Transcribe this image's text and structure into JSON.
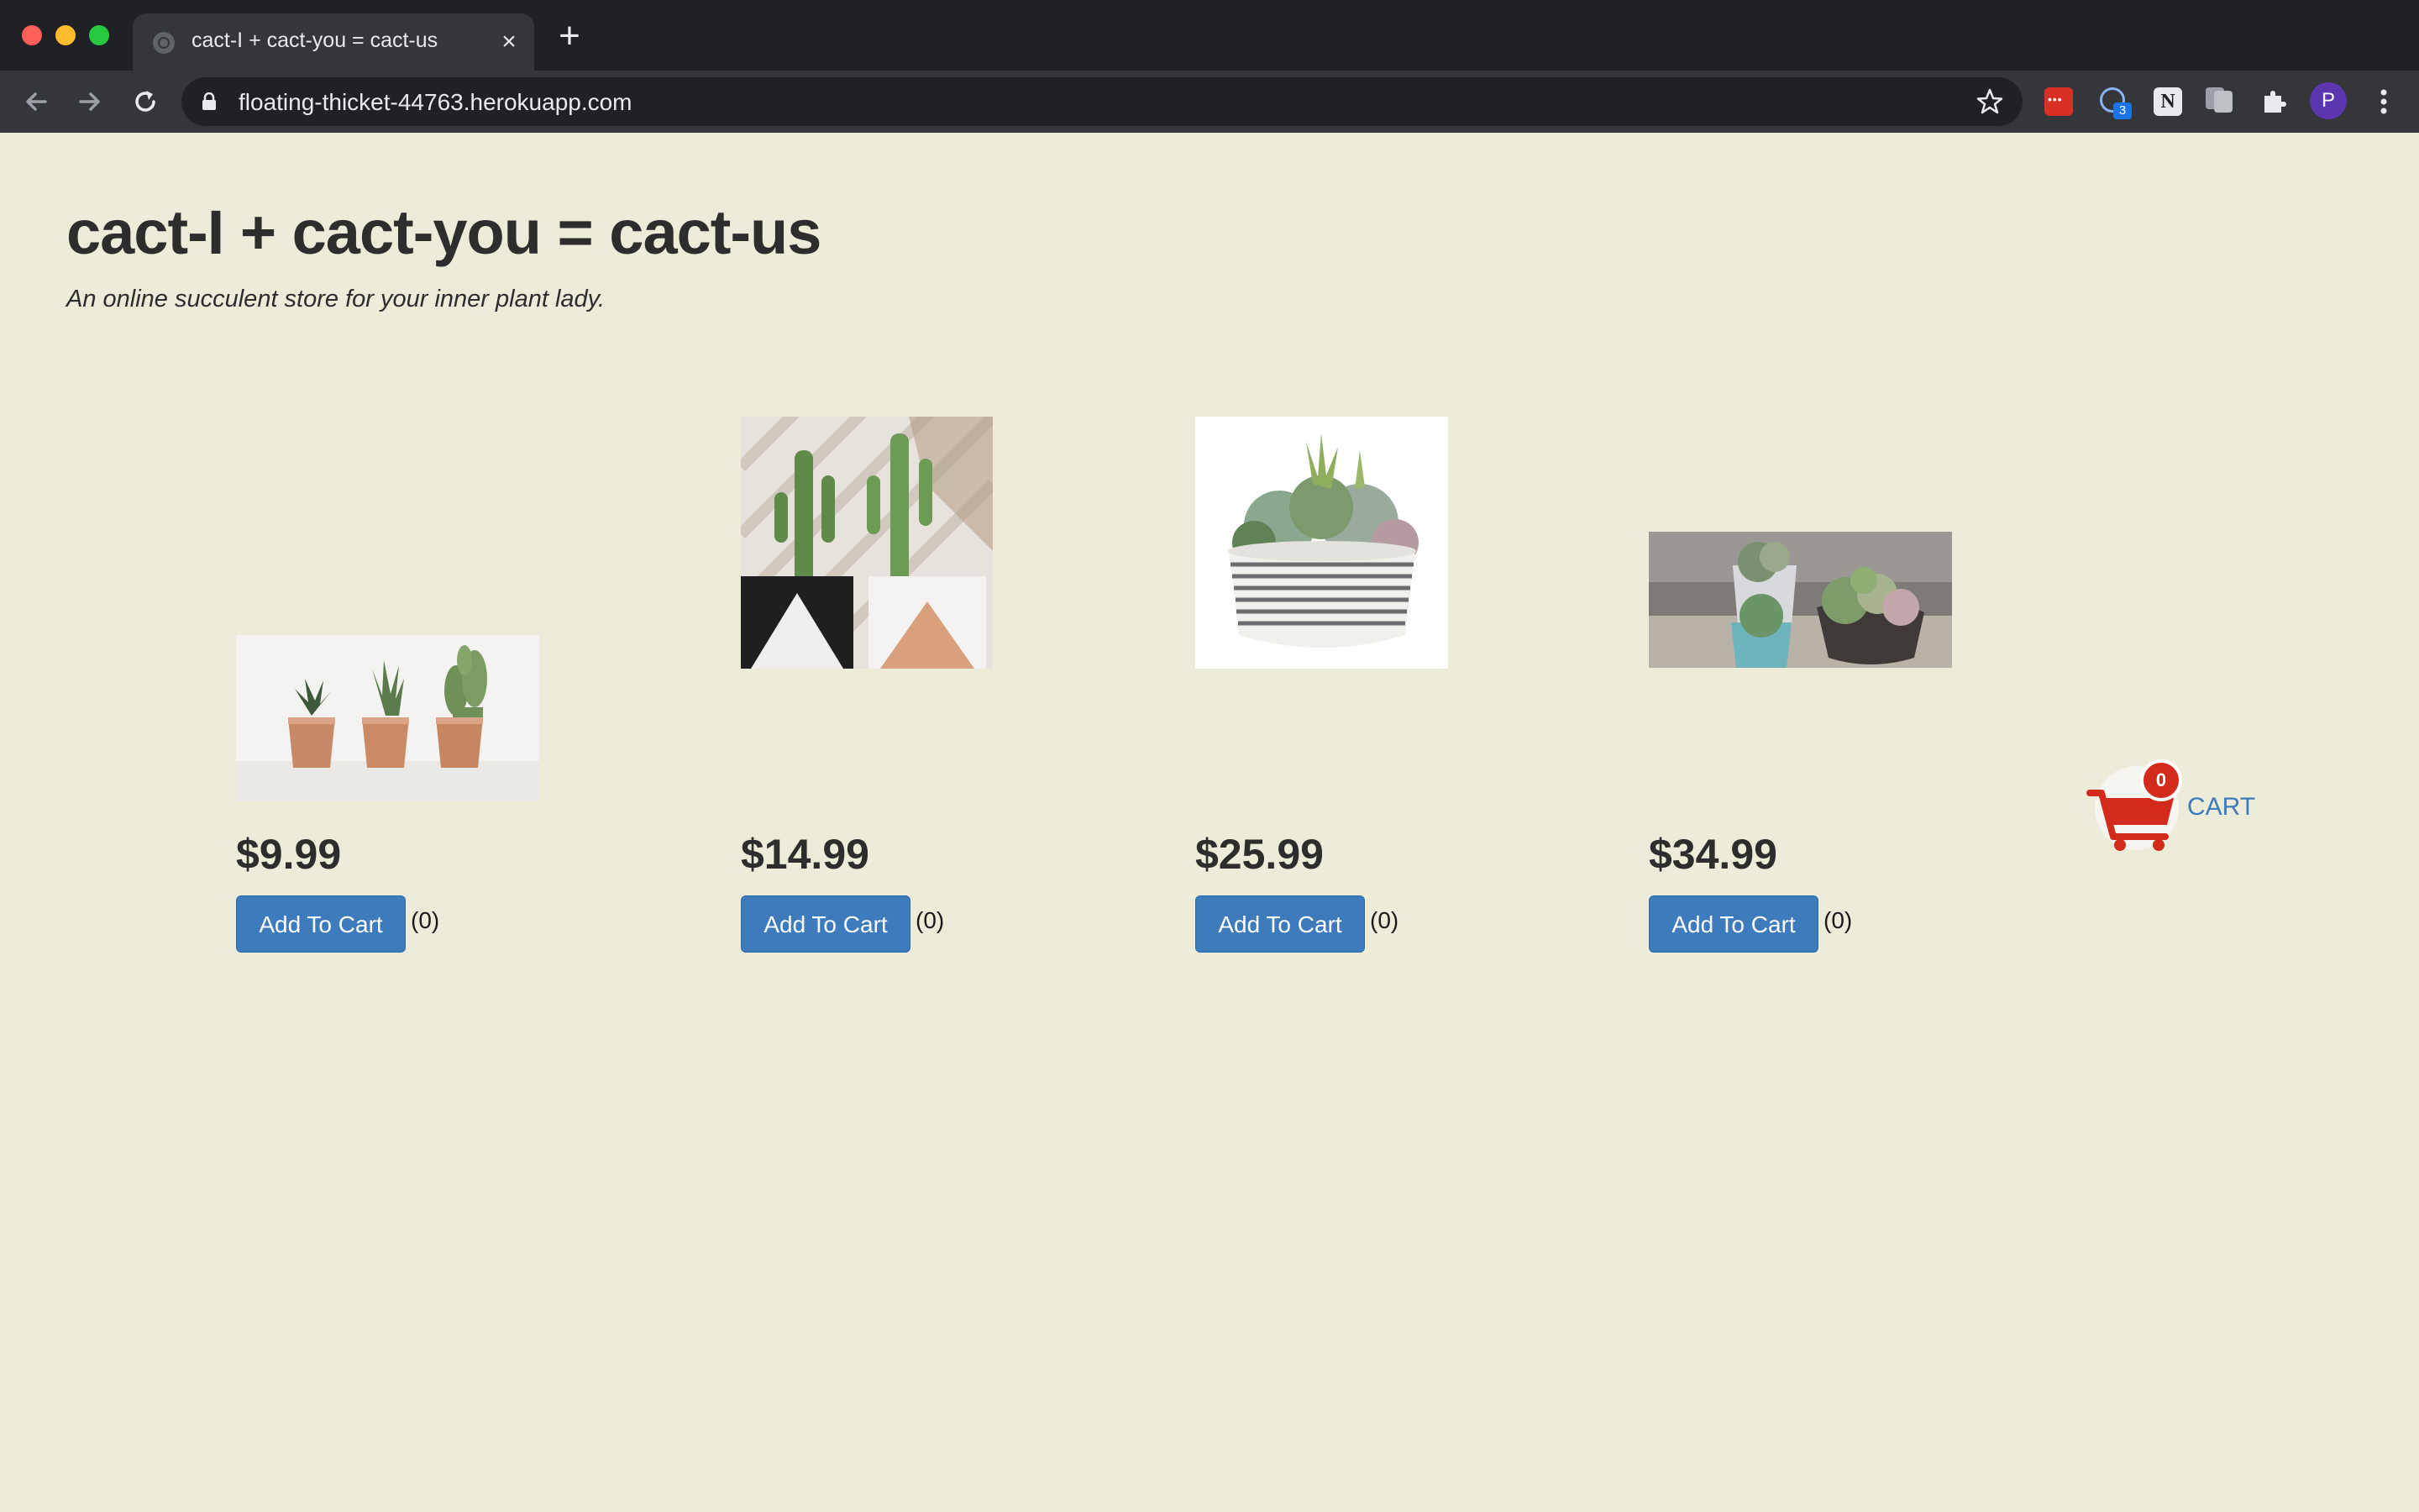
{
  "browser": {
    "tab_title": "cact-I + cact-you = cact-us",
    "close_glyph": "×",
    "new_tab_glyph": "+",
    "url": "floating-thicket-44763.herokuapp.com",
    "extension_badge": "3",
    "extension_notion": "N",
    "profile_initial": "P",
    "icons": [
      "back-arrow-icon",
      "forward-arrow-icon",
      "reload-icon",
      "lock-icon",
      "bookmark-star-icon",
      "extensions-puzzle-icon",
      "kebab-menu-icon"
    ]
  },
  "site": {
    "title": "cact-I + cact-you = cact-us",
    "tagline": "An online succulent store for your inner plant lady."
  },
  "products": [
    {
      "price": "$9.99",
      "button_label": "Add To Cart",
      "quantity": "(0)",
      "image": "three cacti in copper pots"
    },
    {
      "price": "$14.99",
      "button_label": "Add To Cart",
      "quantity": "(0)",
      "image": "two tall cacti in geometric planters"
    },
    {
      "price": "$25.99",
      "button_label": "Add To Cart",
      "quantity": "(0)",
      "image": "succulents in striped round bowl"
    },
    {
      "price": "$34.99",
      "button_label": "Add To Cart",
      "quantity": "(0)",
      "image": "potted succulents on a table"
    }
  ],
  "cart": {
    "count": "0",
    "label": "CART",
    "icon": "shopping-cart-icon",
    "icon_color": "#d22a1b"
  },
  "colors": {
    "page_background": "#edecd8",
    "button": "#3e7bbd",
    "link": "#3e7bbd"
  }
}
